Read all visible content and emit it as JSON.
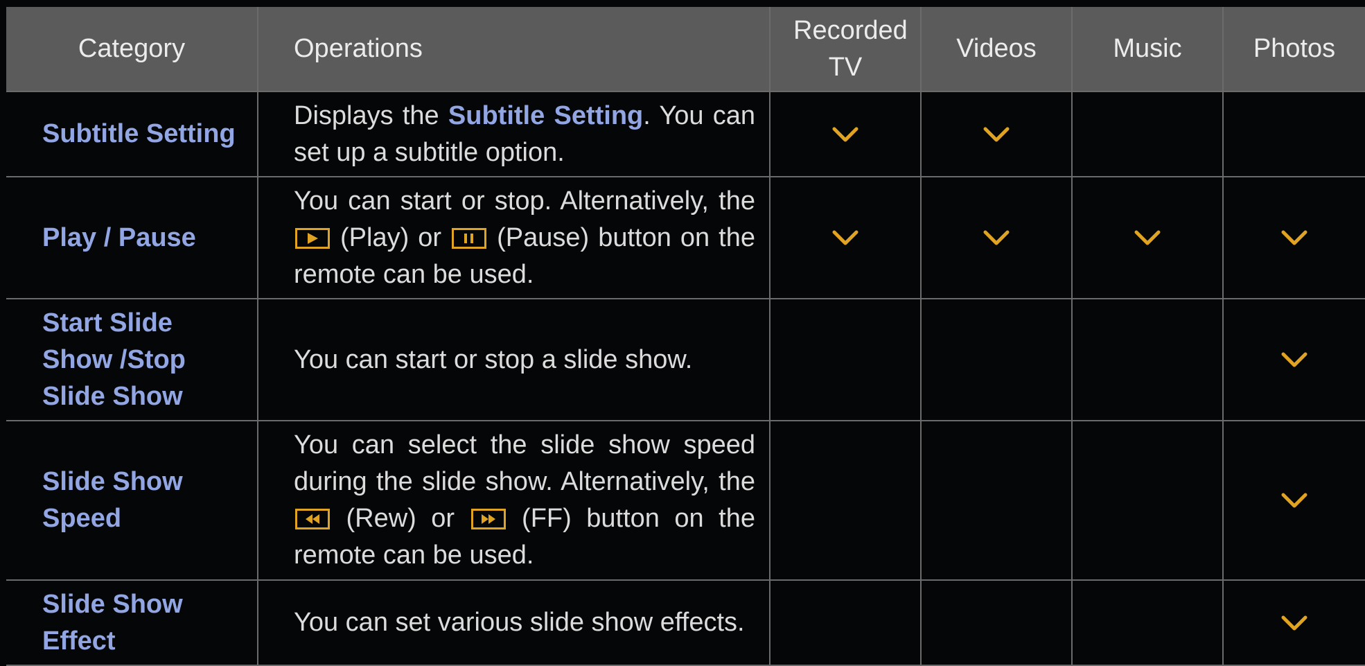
{
  "headers": {
    "category": "Category",
    "operations": "Operations",
    "recorded_tv": "Recorded TV",
    "videos": "Videos",
    "music": "Music",
    "photos": "Photos"
  },
  "rows": [
    {
      "category": "Subtitle Setting",
      "op_pre": "Displays the ",
      "op_highlight": "Subtitle Setting",
      "op_post": ". You can set up a subtitle option.",
      "support": {
        "recorded_tv": true,
        "videos": true,
        "music": false,
        "photos": false
      }
    },
    {
      "category": "Play / Pause",
      "op_a": "You can start or stop. Alternatively, the ",
      "play_icon": "play-button-icon",
      "op_b": " (Play) or ",
      "pause_icon": "pause-button-icon",
      "op_c": " (Pause) button on the remote can be used.",
      "support": {
        "recorded_tv": true,
        "videos": true,
        "music": true,
        "photos": true
      }
    },
    {
      "category": "Start Slide Show /Stop Slide Show",
      "operation": "You can start or stop a slide show.",
      "support": {
        "recorded_tv": false,
        "videos": false,
        "music": false,
        "photos": true
      }
    },
    {
      "category": "Slide Show Speed",
      "op_a": "You can select the slide show speed during the slide show. Alternatively, the ",
      "rew_icon": "rewind-button-icon",
      "op_b": " (Rew) or ",
      "ff_icon": "fast-forward-button-icon",
      "op_c": " (FF) button on the remote can be used.",
      "support": {
        "recorded_tv": false,
        "videos": false,
        "music": false,
        "photos": true
      }
    },
    {
      "category": "Slide Show Effect",
      "operation": "You can set various slide show effects.",
      "support": {
        "recorded_tv": false,
        "videos": false,
        "music": false,
        "photos": true
      }
    }
  ],
  "colors": {
    "header_bg": "#5b5b5b",
    "body_bg": "#050608",
    "category_text": "#93a6e4",
    "check_mark": "#e0a422",
    "grid_line": "#6b6b6b"
  },
  "check_icon": "chevron-check-icon"
}
